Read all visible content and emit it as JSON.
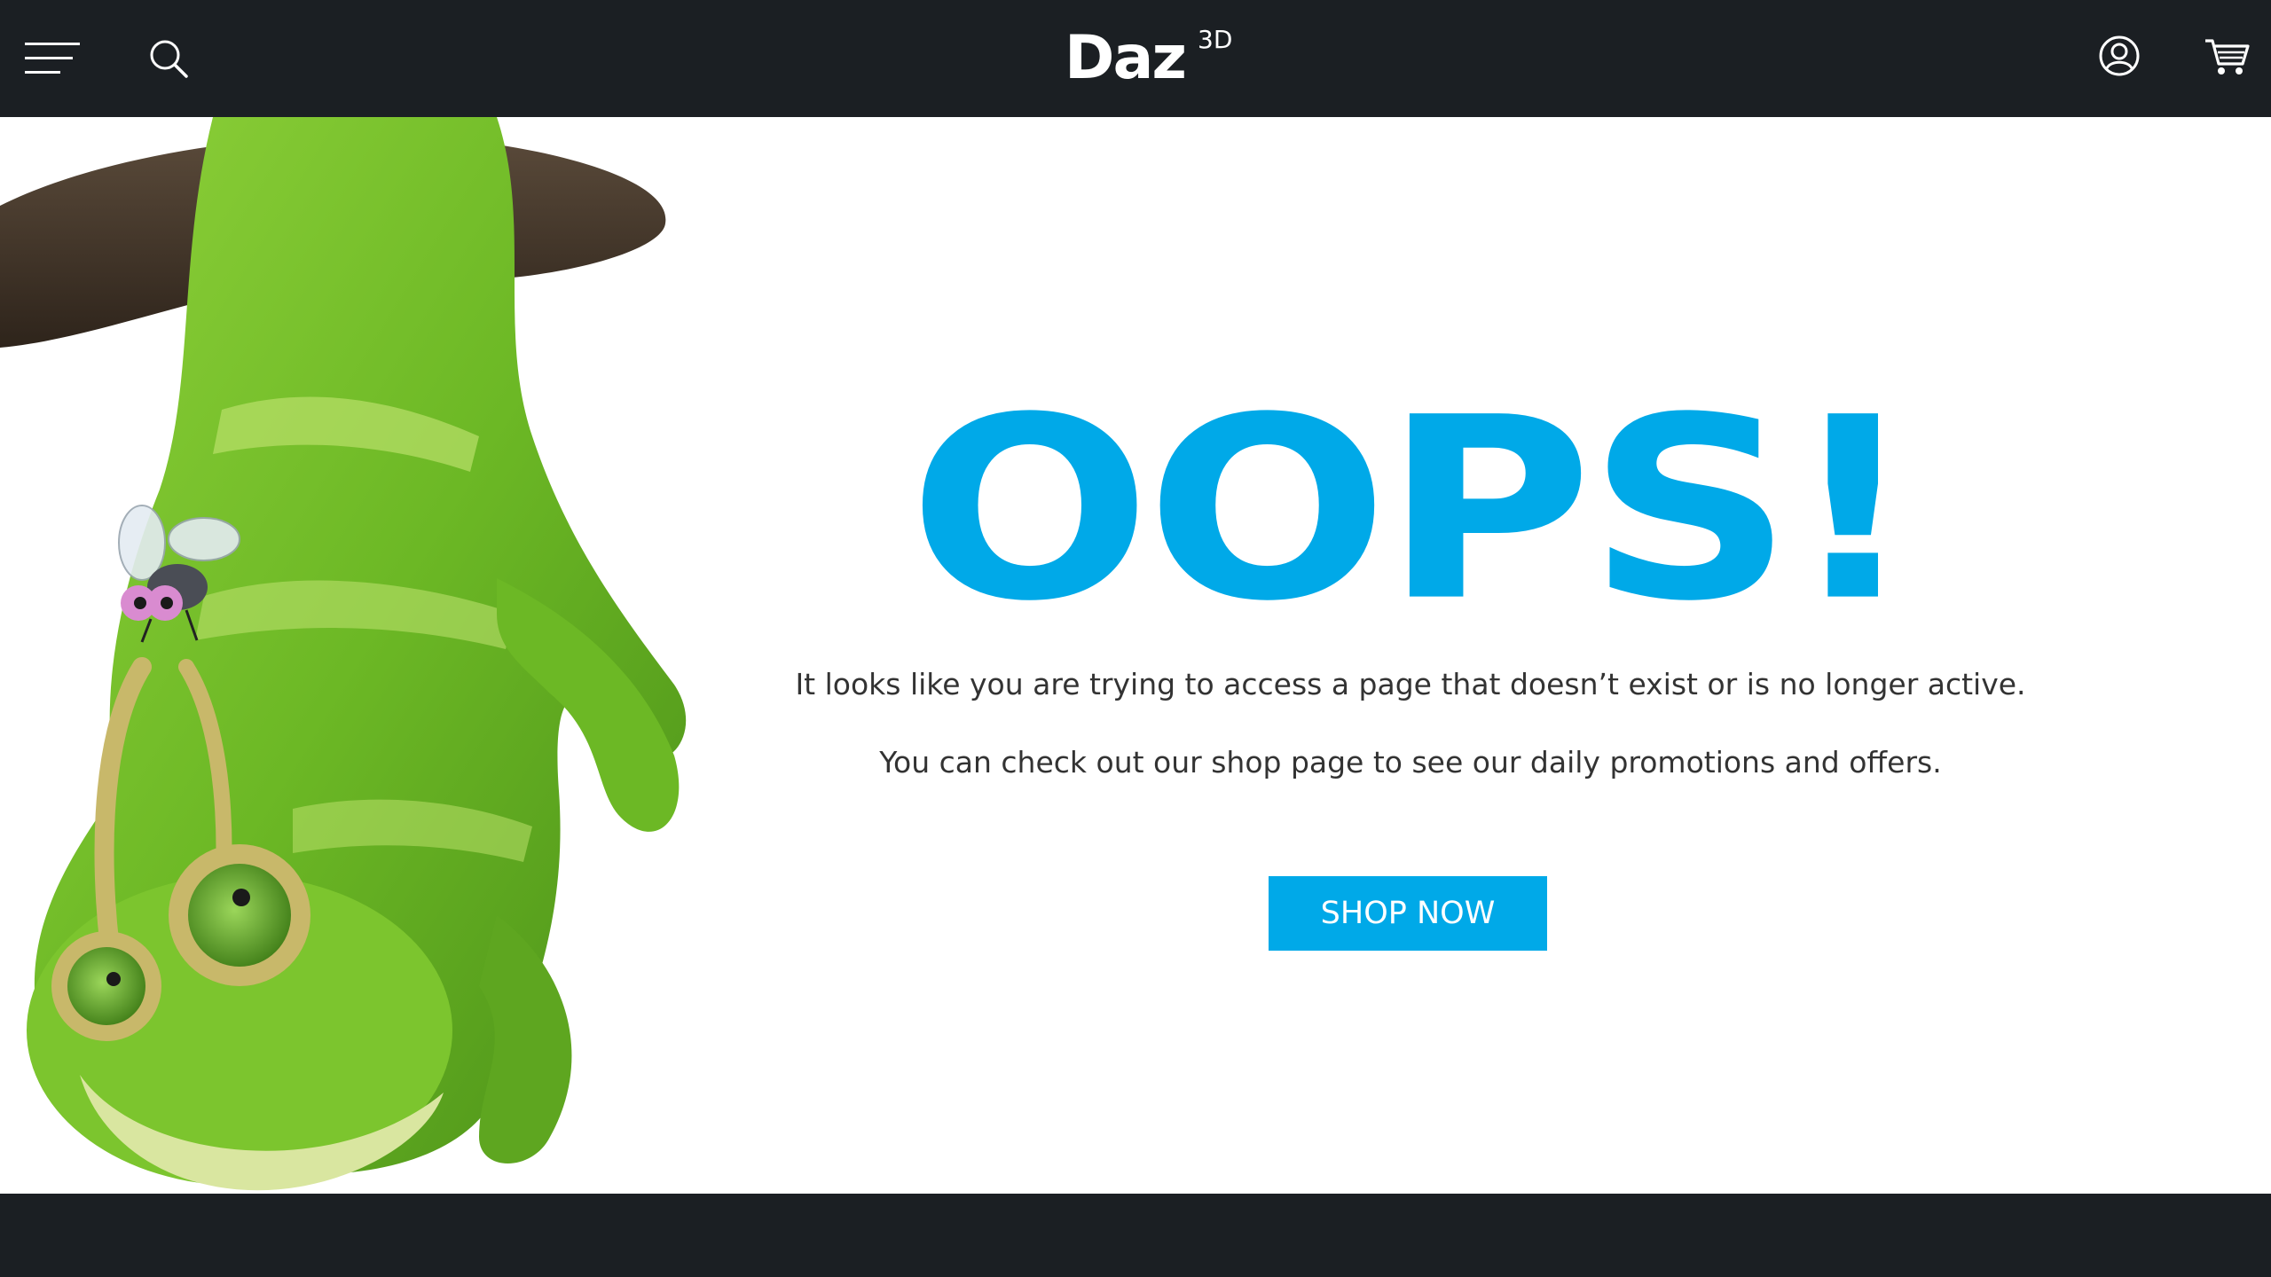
{
  "header": {
    "logo_text": "Daz",
    "logo_superscript": "3D",
    "icons": [
      "menu-icon",
      "search-icon",
      "account-icon",
      "cart-icon"
    ]
  },
  "main": {
    "heading": "OOPS!",
    "message_line_1": "It looks like you are trying to access a page that doesn’t exist or is no longer active.",
    "message_line_2": "You can check out our shop page to see our daily promotions and offers.",
    "button_label": "SHOP NOW"
  },
  "colors": {
    "header_bg": "#1b1f23",
    "accent": "#00a9e8",
    "text": "#333333",
    "background": "#ffffff"
  }
}
